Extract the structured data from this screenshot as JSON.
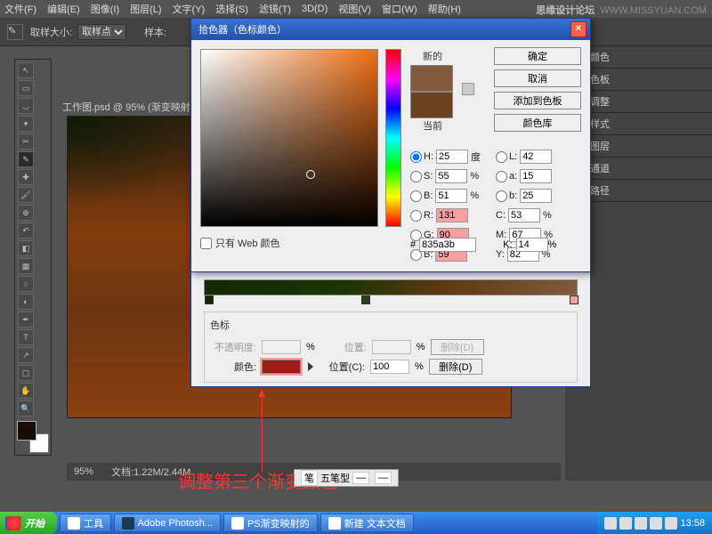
{
  "watermark": {
    "site": "思缘设计论坛",
    "url": "WWW.MISSYUAN.COM"
  },
  "menubar": {
    "items": [
      "文件(F)",
      "编辑(E)",
      "图像(I)",
      "图层(L)",
      "文字(Y)",
      "选择(S)",
      "滤镜(T)",
      "3D(D)",
      "视图(V)",
      "窗口(W)",
      "帮助(H)"
    ]
  },
  "optbar": {
    "label1": "取样大小:",
    "val1": "取样点",
    "label2": "样本:"
  },
  "canvas": {
    "tab": "工作图.psd @ 95% (渐变映射"
  },
  "zoombar": {
    "zoom": "95%",
    "docinfo": "文档:1.22M/2.44M"
  },
  "rightpanels": [
    "颜色",
    "色板",
    "调整",
    "样式",
    "图层",
    "通道",
    "路径"
  ],
  "dialog": {
    "title": "拾色器（色标颜色）",
    "btns": {
      "ok": "确定",
      "cancel": "取消",
      "add": "添加到色板",
      "lib": "颜色库"
    },
    "labels": {
      "new": "新的",
      "current": "当前"
    },
    "hsb": {
      "H": "25",
      "S": "55",
      "B": "51",
      "Hdeg": "度"
    },
    "lab": {
      "L": "42",
      "a": "15",
      "b": "25"
    },
    "rgb": {
      "R": "131",
      "G": "90",
      "B": "59"
    },
    "cmyk": {
      "C": "53",
      "M": "67",
      "Y": "82",
      "K": "14"
    },
    "pct": "%",
    "webonly": "只有 Web 颜色",
    "hex": "835a3b"
  },
  "gradient": {
    "sectitle": "色标",
    "opacity_lbl": "不透明度:",
    "pos_lbl": "位置:",
    "pos2_lbl": "位置(C):",
    "color_lbl": "颜色:",
    "pos_val": "100",
    "del": "删除(D)"
  },
  "annotation": "调整第三个渐变颜色",
  "ime": {
    "name": "五笔型"
  },
  "taskbar": {
    "start": "开始",
    "btns": [
      {
        "label": "工具"
      },
      {
        "label": "Adobe Photosh..."
      },
      {
        "label": "PS渐变映射的"
      },
      {
        "label": "新建 文本文档"
      }
    ],
    "time": "13:58"
  }
}
